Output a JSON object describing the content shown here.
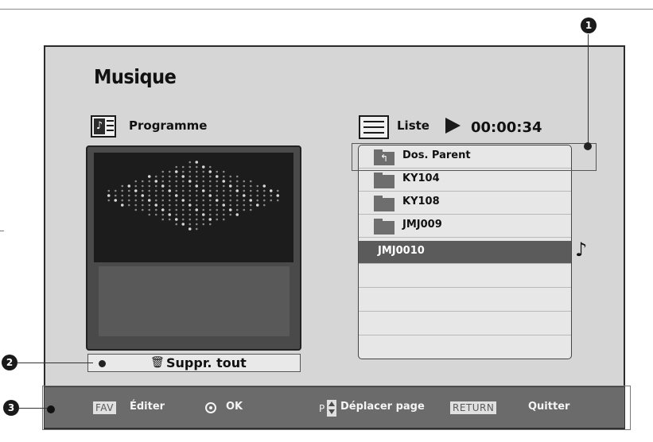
{
  "title": "Musique",
  "programme": {
    "label": "Programme",
    "delete_all_label": "Suppr. tout"
  },
  "liste": {
    "label": "Liste",
    "elapsed_time": "00:00:34",
    "items": [
      {
        "name": "Dos. Parent",
        "type": "parent-folder",
        "selected": false
      },
      {
        "name": "KY104",
        "type": "folder",
        "selected": false
      },
      {
        "name": "KY108",
        "type": "folder",
        "selected": false
      },
      {
        "name": "JMJ009",
        "type": "folder",
        "selected": false
      },
      {
        "name": "JMJ0010",
        "type": "file",
        "selected": true
      }
    ]
  },
  "callouts": {
    "one": "1",
    "two": "2",
    "three": "3"
  },
  "bottom_bar": {
    "fav_key": "FAV",
    "edit_label": "Éditer",
    "ok_label": "OK",
    "page_key": "P",
    "move_page_label": "Déplacer page",
    "return_key": "RETURN",
    "quit_label": "Quitter"
  },
  "icons": {
    "programme": "music-playlist-icon",
    "liste": "list-icon",
    "play": "play-icon",
    "folder": "folder-icon",
    "parent": "parent-folder-icon",
    "trash": "trash-icon",
    "ok": "ok-icon",
    "page_arrows": "page-up-down-icon",
    "note": "music-note-icon"
  },
  "colors": {
    "screen_bg": "#d6d6d6",
    "selected_row": "#5b5b5b",
    "bottom_bar": "#6b6b6b",
    "panel_dark": "#4a4a4a"
  }
}
